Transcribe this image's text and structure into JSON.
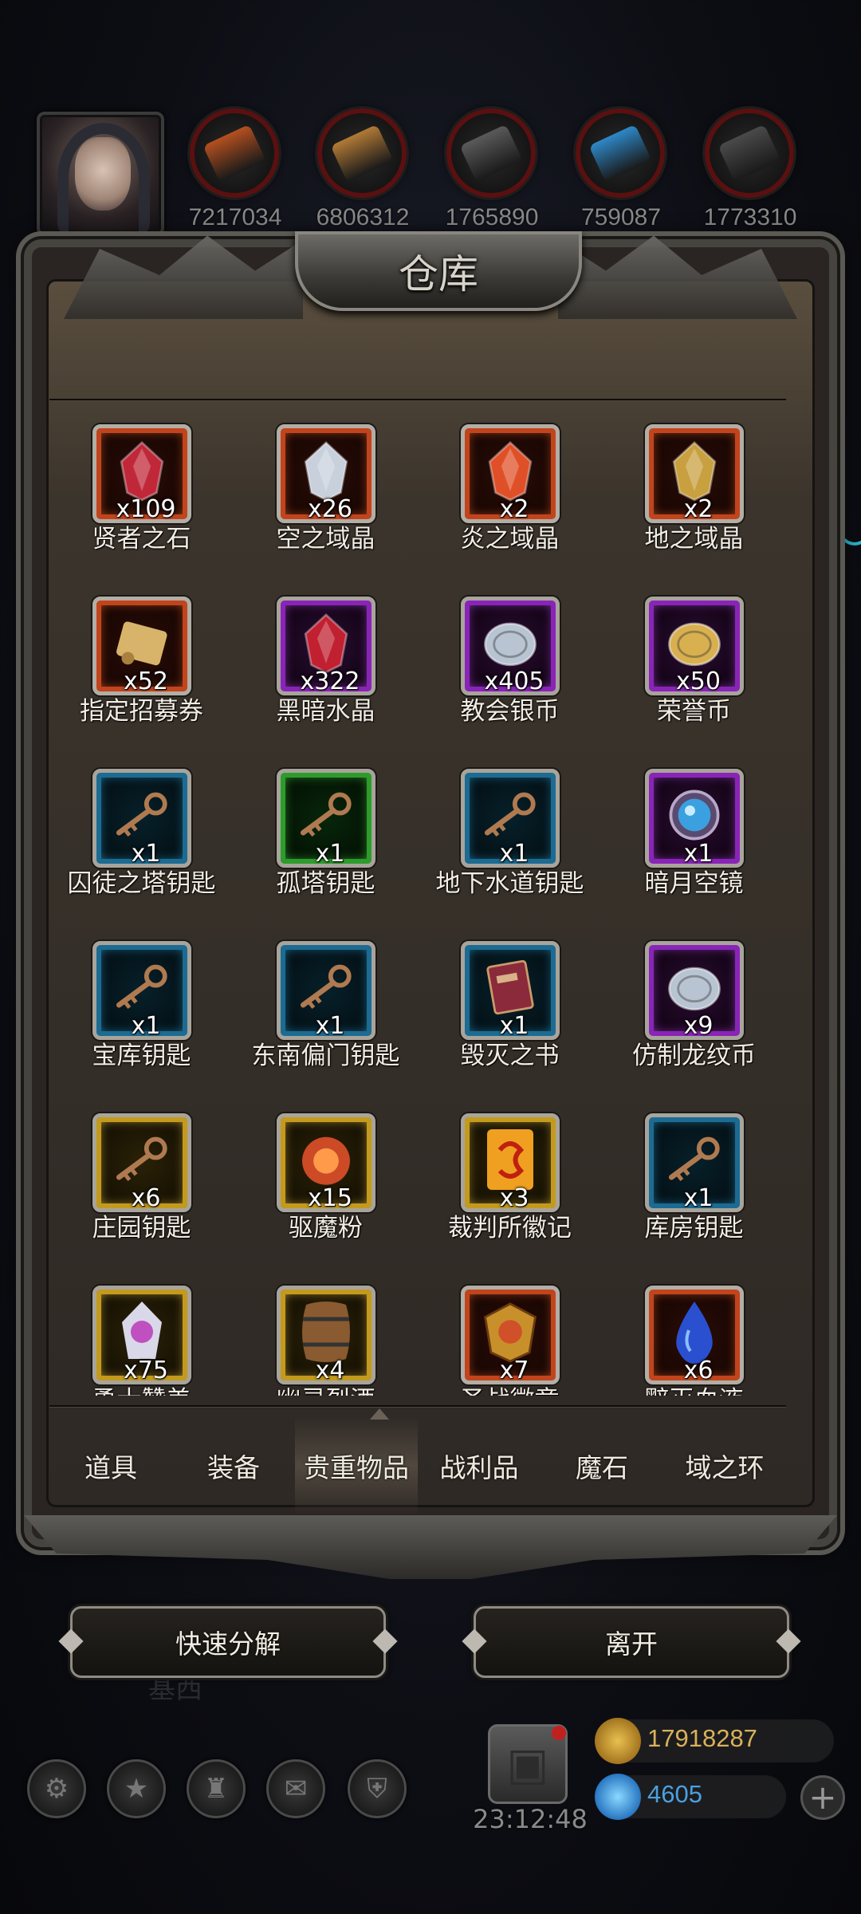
{
  "resources": [
    {
      "icon": "ore-icon",
      "value": "7217034",
      "color": "#b5501f"
    },
    {
      "icon": "wood-planks-icon",
      "value": "6806312",
      "color": "#b27a36"
    },
    {
      "icon": "iron-ingot-icon",
      "value": "1765890",
      "color": "#5a5a5a"
    },
    {
      "icon": "crystal-icon",
      "value": "759087",
      "color": "#2e88c8"
    },
    {
      "icon": "steel-ingot-icon",
      "value": "1773310",
      "color": "#4a4a4a"
    }
  ],
  "panel": {
    "title": "仓库"
  },
  "items": [
    {
      "name": "贤者之石",
      "qty": "x109",
      "quality": "red",
      "icon": "red-stone-icon",
      "color": "#c0283a"
    },
    {
      "name": "空之域晶",
      "qty": "x26",
      "quality": "red",
      "icon": "silver-crystal-icon",
      "color": "#c8d0dc"
    },
    {
      "name": "炎之域晶",
      "qty": "x2",
      "quality": "red",
      "icon": "fire-crystal-icon",
      "color": "#e05028"
    },
    {
      "name": "地之域晶",
      "qty": "x2",
      "quality": "red",
      "icon": "earth-crystal-icon",
      "color": "#c8a040"
    },
    {
      "name": "指定招募券",
      "qty": "x52",
      "quality": "red",
      "icon": "scroll-icon",
      "color": "#d8b46a"
    },
    {
      "name": "黑暗水晶",
      "qty": "x322",
      "quality": "purple",
      "icon": "dark-crystal-icon",
      "color": "#c02030"
    },
    {
      "name": "教会银币",
      "qty": "x405",
      "quality": "purple",
      "icon": "silver-coin-icon",
      "color": "#b8c4d2"
    },
    {
      "name": "荣誉币",
      "qty": "x50",
      "quality": "purple",
      "icon": "gold-coin-icon",
      "color": "#d8b050"
    },
    {
      "name": "囚徒之塔钥匙",
      "qty": "x1",
      "quality": "blue",
      "icon": "key-icon",
      "color": "#b07a50"
    },
    {
      "name": "孤塔钥匙",
      "qty": "x1",
      "quality": "green",
      "icon": "key-icon",
      "color": "#b07a50"
    },
    {
      "name": "地下水道钥匙",
      "qty": "x1",
      "quality": "blue",
      "icon": "key-icon",
      "color": "#b07a50"
    },
    {
      "name": "暗月空镜",
      "qty": "x1",
      "quality": "purple",
      "icon": "mirror-icon",
      "color": "#3aa0e0"
    },
    {
      "name": "宝库钥匙",
      "qty": "x1",
      "quality": "blue",
      "icon": "key-icon",
      "color": "#b07a50"
    },
    {
      "name": "东南偏门钥匙",
      "qty": "x1",
      "quality": "blue",
      "icon": "key-icon",
      "color": "#b07a50"
    },
    {
      "name": "毁灭之书",
      "qty": "x1",
      "quality": "blue",
      "icon": "book-icon",
      "color": "#8a2a3a"
    },
    {
      "name": "仿制龙纹币",
      "qty": "x9",
      "quality": "purple",
      "icon": "silver-coin-icon",
      "color": "#b8c4d2"
    },
    {
      "name": "庄园钥匙",
      "qty": "x6",
      "quality": "gold",
      "icon": "key-icon",
      "color": "#b07a50"
    },
    {
      "name": "驱魔粉",
      "qty": "x15",
      "quality": "gold",
      "icon": "powder-icon",
      "color": "#e0502a"
    },
    {
      "name": "裁判所徽记",
      "qty": "x3",
      "quality": "gold",
      "icon": "emblem-card-icon",
      "color": "#f0a020"
    },
    {
      "name": "库房钥匙",
      "qty": "x1",
      "quality": "blue",
      "icon": "key-icon",
      "color": "#b07a50"
    },
    {
      "name": "勇士赞美",
      "qty": "x75",
      "quality": "gold",
      "icon": "relic-icon",
      "color": "#c050c0"
    },
    {
      "name": "幽灵烈酒",
      "qty": "x4",
      "quality": "gold",
      "icon": "barrel-icon",
      "color": "#8a5a30"
    },
    {
      "name": "圣战徽章",
      "qty": "x7",
      "quality": "red",
      "icon": "badge-icon",
      "color": "#d0502a"
    },
    {
      "name": "黯灭血液",
      "qty": "x6",
      "quality": "red",
      "icon": "blue-drop-icon",
      "color": "#2a50d0"
    }
  ],
  "tabs": [
    {
      "label": "道具",
      "active": false
    },
    {
      "label": "装备",
      "active": false
    },
    {
      "label": "贵重物品",
      "active": true
    },
    {
      "label": "战利品",
      "active": false
    },
    {
      "label": "魔石",
      "active": false
    },
    {
      "label": "域之环",
      "active": false
    }
  ],
  "buttons": {
    "decompose": "快速分解",
    "leave": "离开"
  },
  "hud": {
    "timer": "23:12:48",
    "gold": "17918287",
    "gems": "4605",
    "icons": [
      "settings-icon",
      "star-icon",
      "castle-icon",
      "mail-icon",
      "shield-icon"
    ]
  },
  "background": {
    "faded_text": "基西"
  }
}
